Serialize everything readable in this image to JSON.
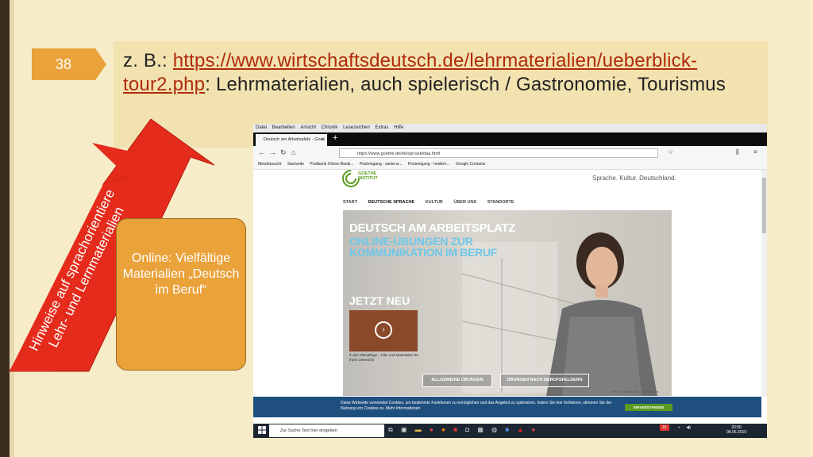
{
  "slide": {
    "number": "38",
    "title_prefix": "z. B.: ",
    "title_link": "https://www.wirtschaftsdeutsch.de/lehrmaterialien/ueberblick-tour2.php",
    "title_suffix": ": Lehrmaterialien, auch spielerisch / Gastronomie, Tourismus",
    "arrow_text_line1": "Hinweise auf sprachorientiere",
    "arrow_text_line2": "Lehr- und Lernmaterialien",
    "callout_text": "Online: Vielfältige Materialien „Deutsch im Beruf“",
    "colors": {
      "accent_red": "#e52b1b",
      "callout_orange": "#eaa23a",
      "link": "#b02a0a"
    }
  },
  "browser": {
    "menu": [
      "Datei",
      "Bearbeiten",
      "Ansicht",
      "Chronik",
      "Lesezeichen",
      "Extras",
      "Hilfe"
    ],
    "tab_title": "Deutsch am Arbeitsplatz - Goe",
    "url": "https://www.goethe.de/de/spr/ueb/daa.html",
    "bookmarks": [
      "Meistbesucht",
      "Startseite",
      "Postbank Online-Banki...",
      "Posteingang - sarter.w...",
      "Posteingang - heidem...",
      "Google Contacts"
    ]
  },
  "site": {
    "logo_line1": "GOETHE",
    "logo_line2": "INSTITUT",
    "slogan": "Sprache. Kultur. Deutschland.",
    "nav": [
      "START",
      "DEUTSCHE SPRACHE",
      "KULTUR",
      "ÜBER UNS",
      "STANDORTE"
    ],
    "hero_title": "DEUTSCH AM ARBEITSPLATZ",
    "hero_subtitle": "ONLINE-ÜBUNGEN ZUR KOMMUNIKATION IM BERUF",
    "hero_new": "JETZT NEU",
    "thumb_caption": "In der Altenpflege – Film und Materialien für Ihren Unterricht",
    "button_general": "ALLGEMEINE ÜBUNGEN",
    "button_fields": "ÜBUNGEN NACH BERUFSFELDERN",
    "photo_credit": "Foto: © Westend61 – Fotolia.com",
    "cookie_text": "Diese Webseite verwendet Cookies, um bestimmte Funktionen zu ermöglichen und das Angebot zu optimieren. Indem Sie hier fortfahren, stimmen Sie der Nutzung von Cookies zu. Mehr Informationen",
    "cookie_button": "EINVERSTANDEN"
  },
  "taskbar": {
    "search_placeholder": "Zur Suche Text hier eingeben",
    "badge": "16",
    "time": "20:56",
    "date": "08.05.2019"
  }
}
